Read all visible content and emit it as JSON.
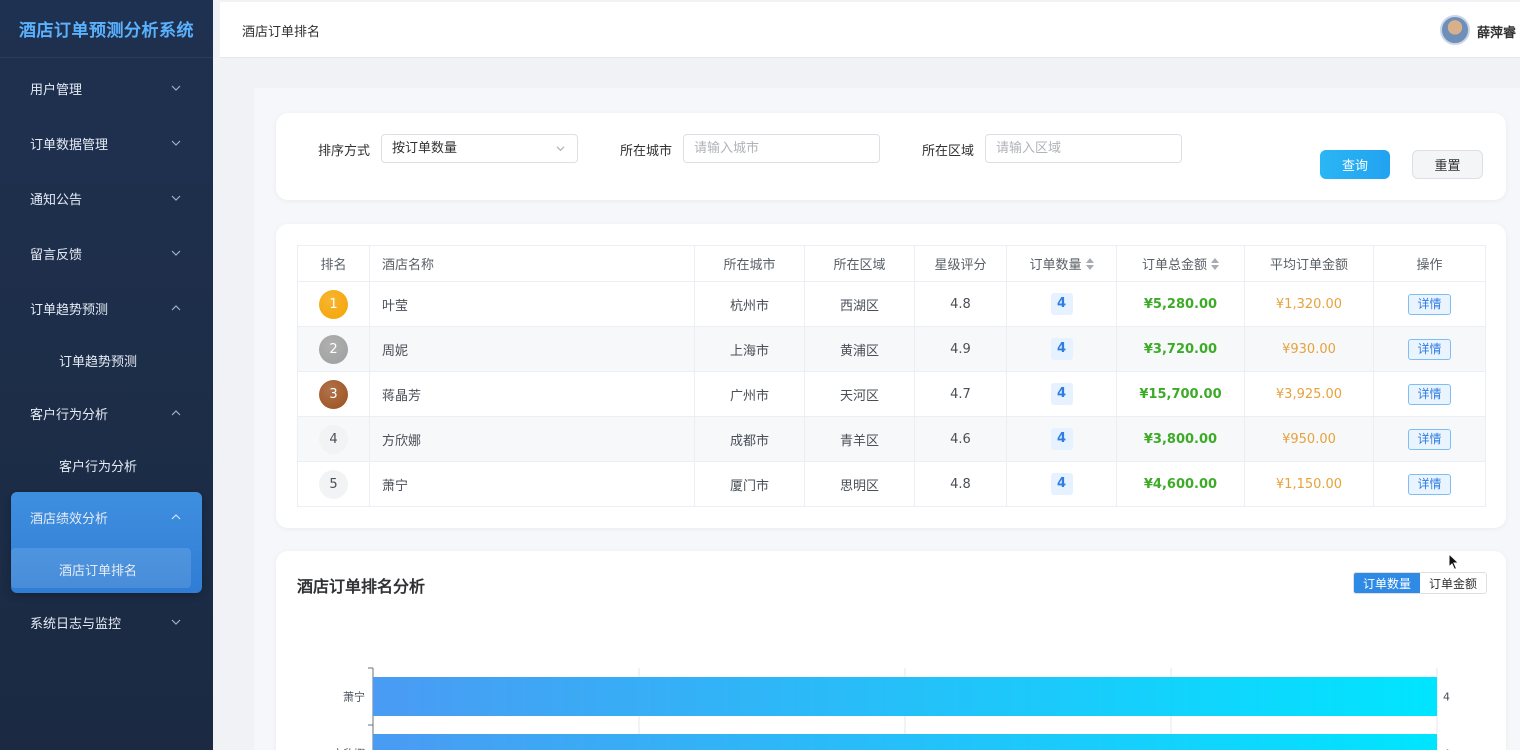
{
  "sidebar": {
    "title": "酒店订单预测分析系统",
    "menu": [
      {
        "label": "用户管理",
        "expanded": false
      },
      {
        "label": "订单数据管理",
        "expanded": false
      },
      {
        "label": "通知公告",
        "expanded": false
      },
      {
        "label": "留言反馈",
        "expanded": false
      },
      {
        "label": "订单趋势预测",
        "expanded": true,
        "sub": "订单趋势预测"
      },
      {
        "label": "客户行为分析",
        "expanded": true,
        "sub": "客户行为分析"
      },
      {
        "label": "酒店绩效分析",
        "expanded": true,
        "sub": "酒店订单排名",
        "active": true
      },
      {
        "label": "系统日志与监控",
        "expanded": false
      }
    ]
  },
  "header": {
    "breadcrumb": "酒店订单排名",
    "username": "薛萍睿"
  },
  "filters": {
    "sort_label": "排序方式",
    "sort_value": "按订单数量",
    "city_label": "所在城市",
    "city_placeholder": "请输入城市",
    "district_label": "所在区域",
    "district_placeholder": "请输入区域",
    "query_button": "查询",
    "reset_button": "重置"
  },
  "table": {
    "headers": [
      "排名",
      "酒店名称",
      "所在城市",
      "所在区域",
      "星级评分",
      "订单数量",
      "订单总金额",
      "平均订单金额",
      "操作"
    ],
    "rows": [
      {
        "rank": "1",
        "name": "叶莹",
        "city": "杭州市",
        "district": "西湖区",
        "rating": "4.8",
        "count": "4",
        "total": "¥5,280.00",
        "avg": "¥1,320.00",
        "action": "详情"
      },
      {
        "rank": "2",
        "name": "周妮",
        "city": "上海市",
        "district": "黄浦区",
        "rating": "4.9",
        "count": "4",
        "total": "¥3,720.00",
        "avg": "¥930.00",
        "action": "详情"
      },
      {
        "rank": "3",
        "name": "蒋晶芳",
        "city": "广州市",
        "district": "天河区",
        "rating": "4.7",
        "count": "4",
        "total": "¥15,700.00",
        "avg": "¥3,925.00",
        "action": "详情"
      },
      {
        "rank": "4",
        "name": "方欣娜",
        "city": "成都市",
        "district": "青羊区",
        "rating": "4.6",
        "count": "4",
        "total": "¥3,800.00",
        "avg": "¥950.00",
        "action": "详情"
      },
      {
        "rank": "5",
        "name": "萧宁",
        "city": "厦门市",
        "district": "思明区",
        "rating": "4.8",
        "count": "4",
        "total": "¥4,600.00",
        "avg": "¥1,150.00",
        "action": "详情"
      }
    ],
    "rank_colors": {
      "1": "#f5a300",
      "2": "#9e9e9e",
      "3": "#9c4f1d"
    }
  },
  "chart_section": {
    "title": "酒店订单排名分析",
    "toggle_on": "订单数量",
    "toggle_off": "订单金额"
  },
  "chart_data": {
    "type": "bar",
    "orientation": "horizontal",
    "categories": [
      "萧宁",
      "方欣娜"
    ],
    "values": [
      4,
      4
    ],
    "xlim": [
      0,
      4
    ],
    "grid": true,
    "colors": [
      "#4a9bf3",
      "#00e5ff"
    ]
  }
}
